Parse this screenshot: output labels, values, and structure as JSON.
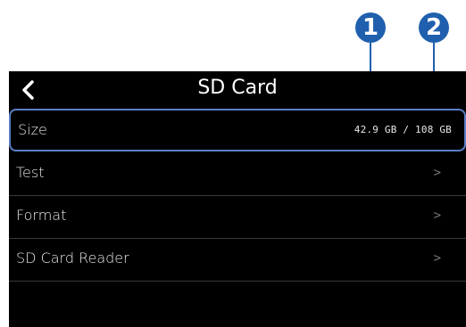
{
  "callouts": [
    "1",
    "2"
  ],
  "screen": {
    "title": "SD Card",
    "back_icon": "chevron-left-icon",
    "size": {
      "label": "Size",
      "used": "42.9",
      "unit": "GB",
      "separator": "/",
      "total": "108",
      "total_unit": "GB"
    },
    "items": [
      {
        "label": "Test",
        "chevron": ">"
      },
      {
        "label": "Format",
        "chevron": ">"
      },
      {
        "label": "SD Card Reader",
        "chevron": ">"
      }
    ]
  }
}
